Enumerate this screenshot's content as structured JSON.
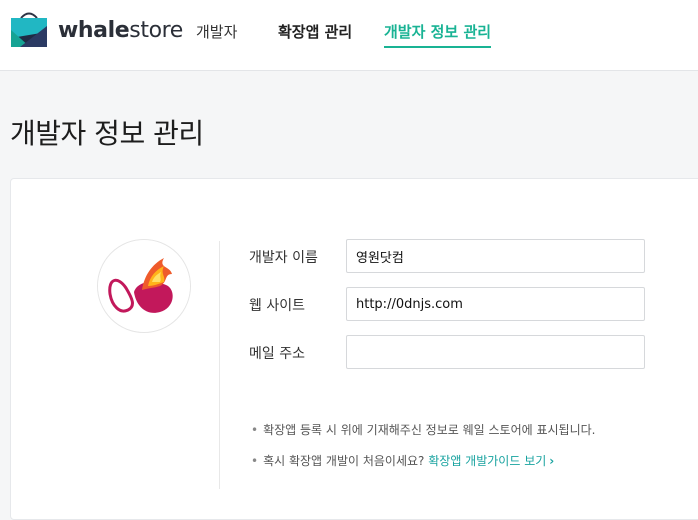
{
  "header": {
    "brand_bold": "whale",
    "brand_light": "store",
    "nav": [
      {
        "label": "개발자"
      },
      {
        "label": "확장앱 관리"
      },
      {
        "label": "개발자 정보 관리"
      }
    ],
    "accent_color": "#19b394"
  },
  "page": {
    "title": "개발자 정보 관리"
  },
  "form": {
    "name_label": "개발자 이름",
    "name_value": "영원닷컴",
    "website_label": "웹 사이트",
    "website_value": "http://0dnjs.com",
    "email_label": "메일 주소",
    "email_value": ""
  },
  "notes": {
    "line1": "확장앱 등록 시 위에 기재해주신 정보로 웨일 스토어에 표시됩니다.",
    "line2_text": "혹시 확장앱 개발이 처음이세요?",
    "line2_link": "확장앱 개발가이드 보기",
    "link_icon": "chevron-right-icon"
  }
}
